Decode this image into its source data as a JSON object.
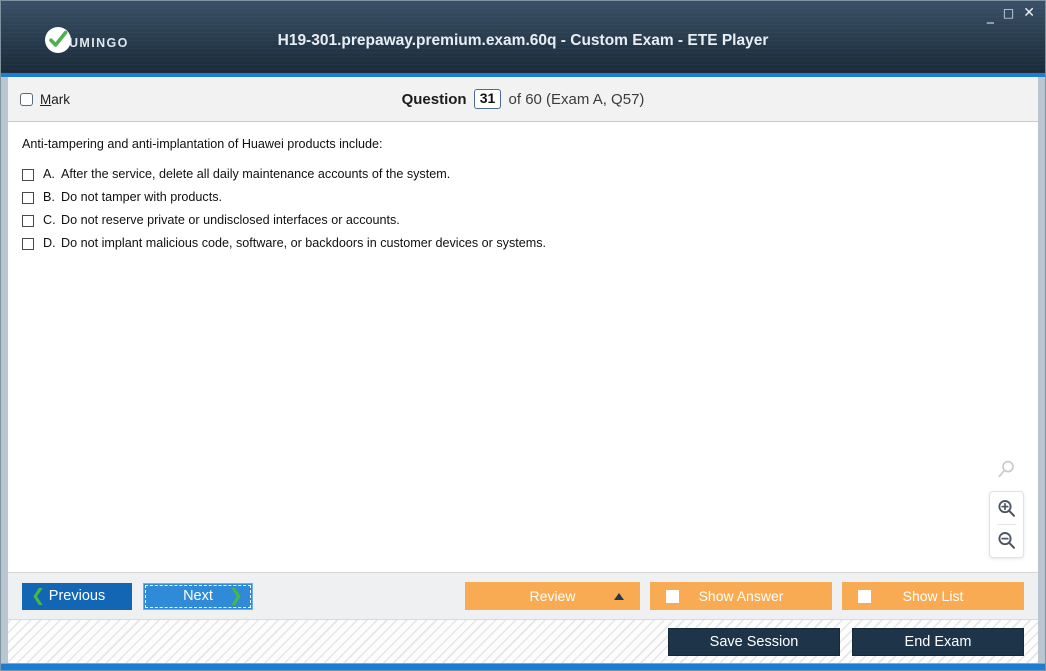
{
  "window": {
    "title": "H19-301.prepaway.premium.exam.60q - Custom Exam - ETE Player",
    "logo_text": "UMINGO",
    "controls": {
      "minimize": "_",
      "maximize": "□",
      "close": "✕"
    },
    "accent_color": "#1a7fd4",
    "titlebar_color": "#25384a"
  },
  "question_header": {
    "mark_label_accel": "M",
    "mark_label_rest": "ark",
    "question_word": "Question",
    "question_number": "31",
    "rest": "of 60 (Exam A, Q57)"
  },
  "question": {
    "prompt": "Anti-tampering and anti-implantation of Huawei products include:",
    "options": [
      {
        "letter": "A.",
        "text": "After the service, delete all daily maintenance accounts of the system.",
        "checked": false
      },
      {
        "letter": "B.",
        "text": "Do not tamper with products.",
        "checked": false
      },
      {
        "letter": "C.",
        "text": "Do not reserve private or undisclosed interfaces or accounts.",
        "checked": false
      },
      {
        "letter": "D.",
        "text": "Do not implant malicious code, software, or backdoors in customer devices or systems.",
        "checked": false
      }
    ]
  },
  "zoom_tools": {
    "magnifier": "search-icon",
    "zoom_in": "zoom-in-icon",
    "zoom_out": "zoom-out-icon"
  },
  "toolbar": {
    "previous_label": "Previous",
    "next_label": "Next",
    "review_label": "Review",
    "show_answer_label": "Show Answer",
    "show_list_label": "Show List",
    "orange_color": "#f8ab52",
    "previous_color": "#1266b4",
    "next_color": "#2f8ad8"
  },
  "status_bar": {
    "save_session_label": "Save Session",
    "end_exam_label": "End Exam",
    "dark_button_color": "#1e3448"
  }
}
